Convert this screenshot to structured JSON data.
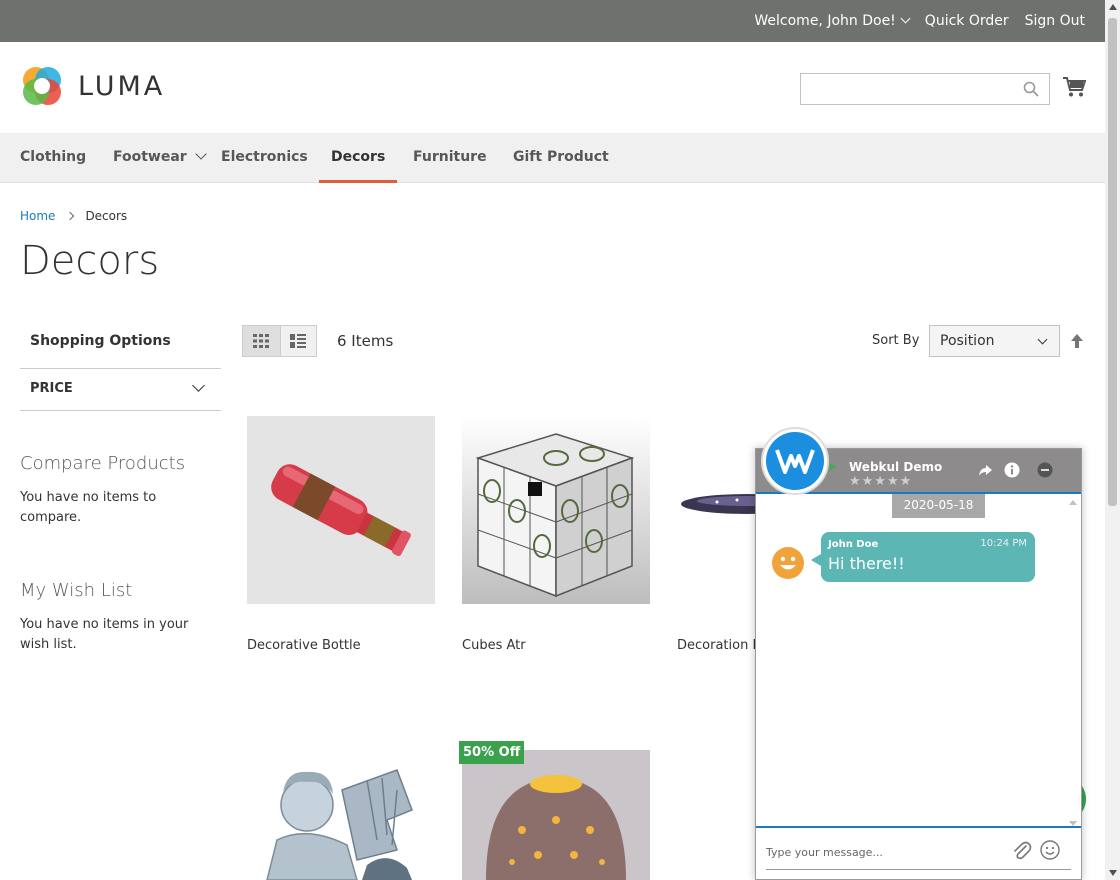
{
  "topbar": {
    "welcome": "Welcome, John Doe!",
    "quick_order": "Quick Order",
    "sign_out": "Sign Out"
  },
  "header": {
    "logo_text": "LUMA",
    "search_placeholder": ""
  },
  "nav": {
    "items": [
      "Clothing",
      "Footwear",
      "Electronics",
      "Decors",
      "Furniture",
      "Gift Product"
    ],
    "active": "Decors"
  },
  "breadcrumb": {
    "home": "Home",
    "current": "Decors"
  },
  "page_title": "Decors",
  "sidebar": {
    "shopping_options": "Shopping Options",
    "price_filter": "PRICE",
    "compare_title": "Compare Products",
    "compare_text": "You have no items to compare.",
    "wishlist_title": "My Wish List",
    "wishlist_text": "You have no items in your wish list."
  },
  "toolbar": {
    "items_count": "6 Items",
    "sort_label": "Sort By",
    "sort_value": "Position"
  },
  "products": [
    {
      "name": "Decorative Bottle"
    },
    {
      "name": "Cubes Atr"
    },
    {
      "name": "Decoration L"
    },
    {
      "name": ""
    },
    {
      "name": ""
    }
  ],
  "badge": "50% Off",
  "chat": {
    "agent_name": "Webkul Demo",
    "stars": "★★★★★",
    "date": "2020-05-18",
    "message": {
      "sender": "John Doe",
      "time": "10:24 PM",
      "text": "Hi there!!"
    },
    "input_placeholder": "Type your message..."
  },
  "colors": {
    "topbar": "#6e716e",
    "nav_active_underline": "#e25d3c",
    "link": "#1979c3",
    "chat_bubble": "#5cb6b3",
    "badge": "#3aa14c"
  }
}
